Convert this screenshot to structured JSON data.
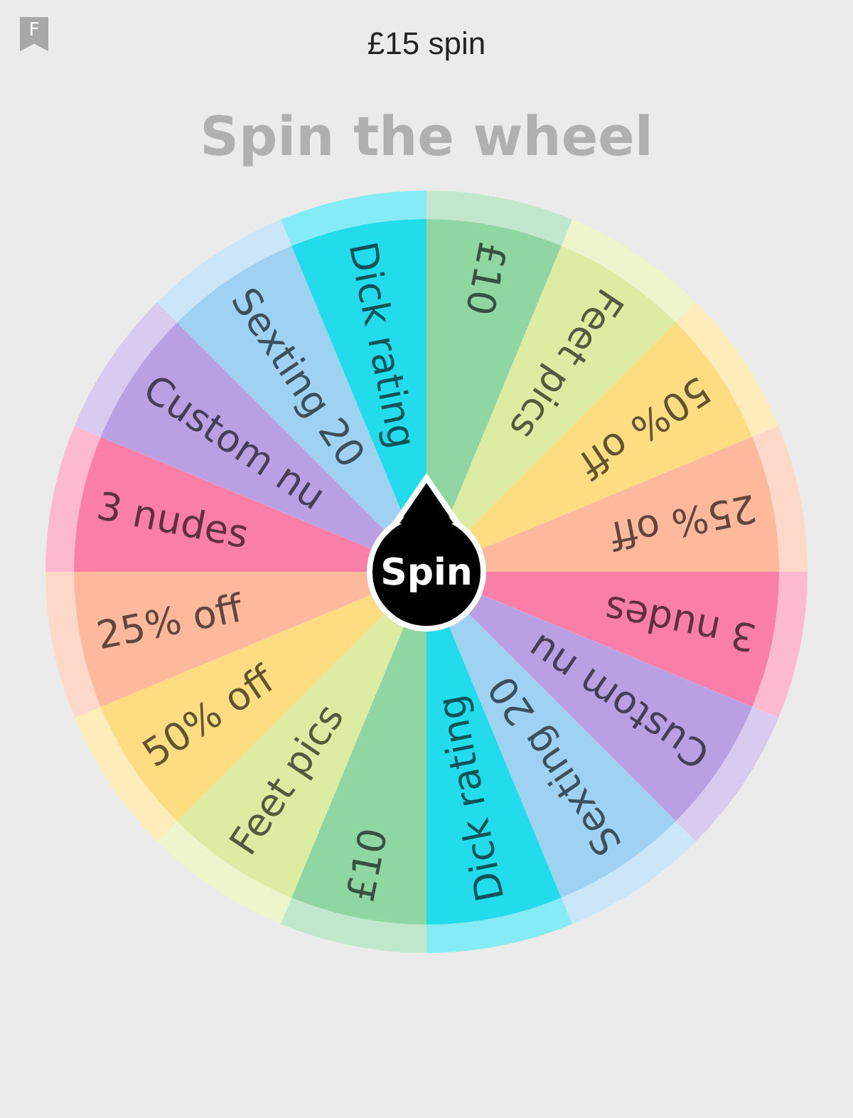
{
  "header": {
    "badge": "F",
    "title": "£15 spin"
  },
  "title": "Spin the wheel",
  "wheel": {
    "segments": [
      {
        "label": "£10",
        "color": "#8fd6a2"
      },
      {
        "label": "Feet pics",
        "color": "#dcecA2"
      },
      {
        "label": "50% off",
        "color": "#fedd82"
      },
      {
        "label": "25% off",
        "color": "#feb99c"
      },
      {
        "label": "3 nudes",
        "color": "#fa7fa8"
      },
      {
        "label": "Custom nu",
        "color": "#b9a0e2"
      },
      {
        "label": "Sexting 20",
        "color": "#9fd2f2"
      },
      {
        "label": "Dick rating",
        "color": "#22dcec"
      },
      {
        "label": "£10",
        "color": "#8fd6a2"
      },
      {
        "label": "Feet pics",
        "color": "#dcecA2"
      },
      {
        "label": "50% off",
        "color": "#fedd82"
      },
      {
        "label": "25% off",
        "color": "#feb99c"
      },
      {
        "label": "3 nudes",
        "color": "#fa7fa8"
      },
      {
        "label": "Custom nu",
        "color": "#b9a0e2"
      },
      {
        "label": "Sexting 20",
        "color": "#9fd2f2"
      },
      {
        "label": "Dick rating",
        "color": "#22dcec"
      }
    ],
    "button": "Spin"
  }
}
